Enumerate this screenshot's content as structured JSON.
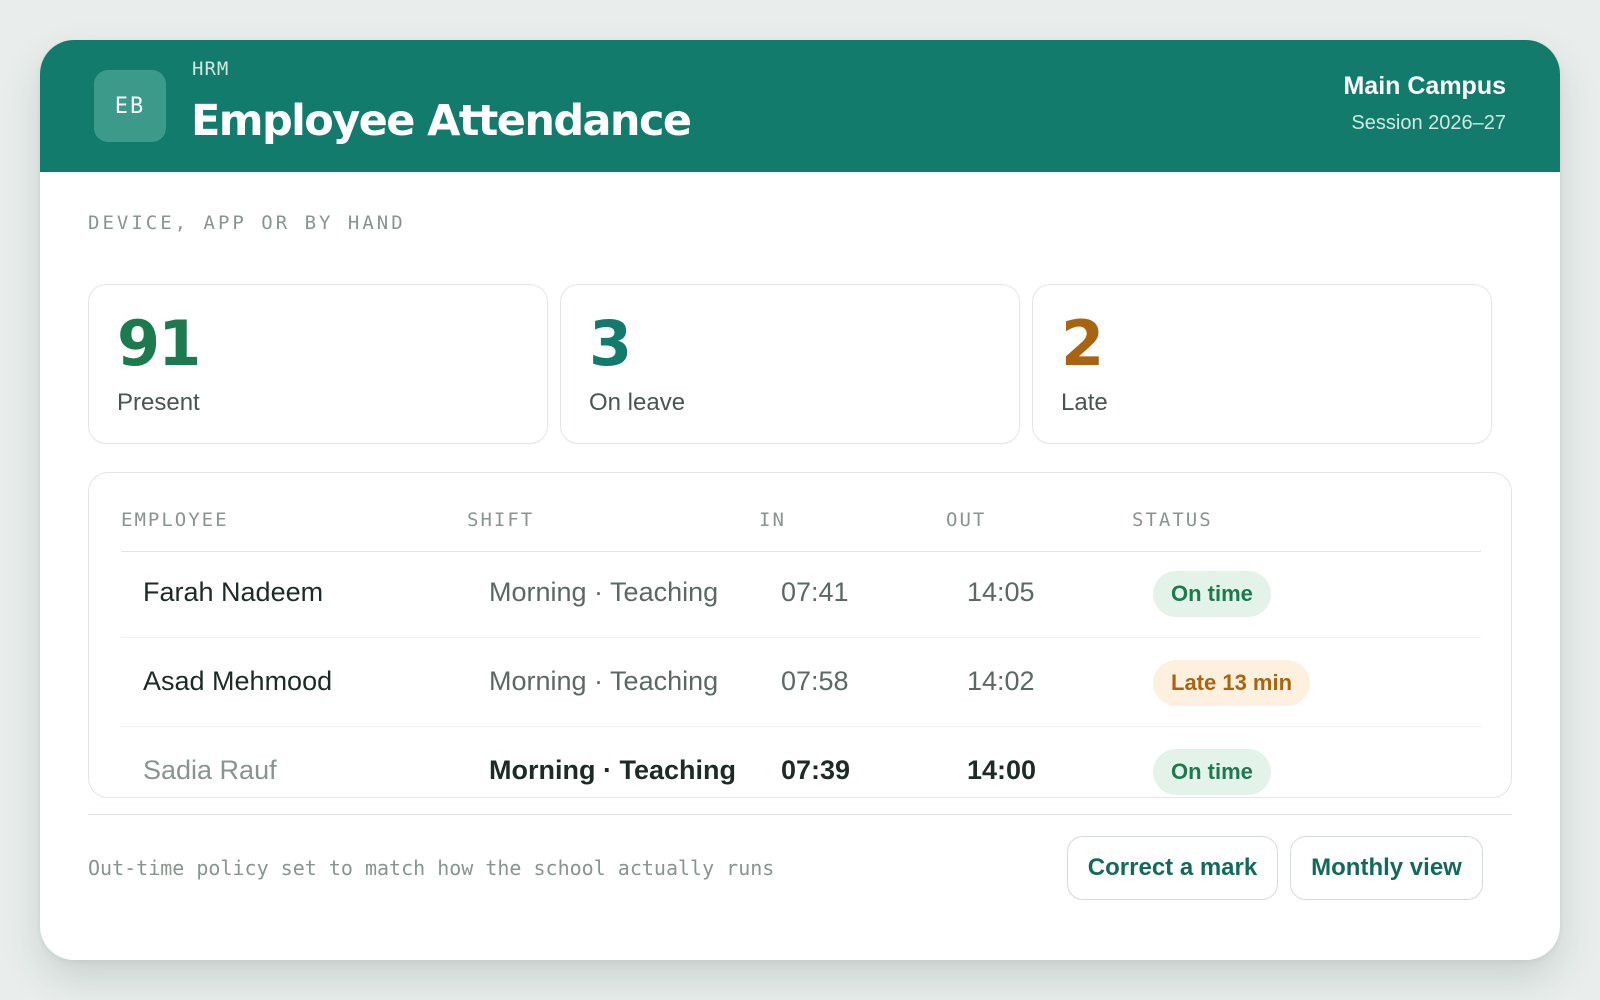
{
  "header": {
    "logo_initials": "EB",
    "eyebrow": "HRM",
    "title": "Employee Attendance",
    "campus": "Main Campus",
    "session": "Session 2026–27"
  },
  "subheading": "DEVICE, APP OR BY HAND",
  "stats": [
    {
      "value": "91",
      "label": "Present",
      "color": "#1d7a4e"
    },
    {
      "value": "3",
      "label": "On leave",
      "color": "#137b6c"
    },
    {
      "value": "2",
      "label": "Late",
      "color": "#a86411"
    }
  ],
  "table": {
    "columns": [
      "EMPLOYEE",
      "SHIFT",
      "IN",
      "OUT",
      "STATUS"
    ],
    "rows": [
      {
        "name": "Farah Nadeem",
        "shift": "Morning · Teaching",
        "in": "07:41",
        "out": "14:05",
        "status": "On time",
        "status_kind": "ok"
      },
      {
        "name": "Asad Mehmood",
        "shift": "Morning · Teaching",
        "in": "07:58",
        "out": "14:02",
        "status": "Late 13 min",
        "status_kind": "late"
      },
      {
        "name": "Sadia Rauf",
        "shift": "Morning · Teaching",
        "in": "07:39",
        "out": "14:00",
        "status": "On time",
        "status_kind": "ok"
      }
    ]
  },
  "footer": {
    "note": "Out-time policy set to match how the school actually runs",
    "correct_label": "Correct a mark",
    "monthly_label": "Monthly view"
  },
  "colors": {
    "brand": "#137b6c",
    "ok": "#1d7a4e",
    "late": "#a86411"
  }
}
